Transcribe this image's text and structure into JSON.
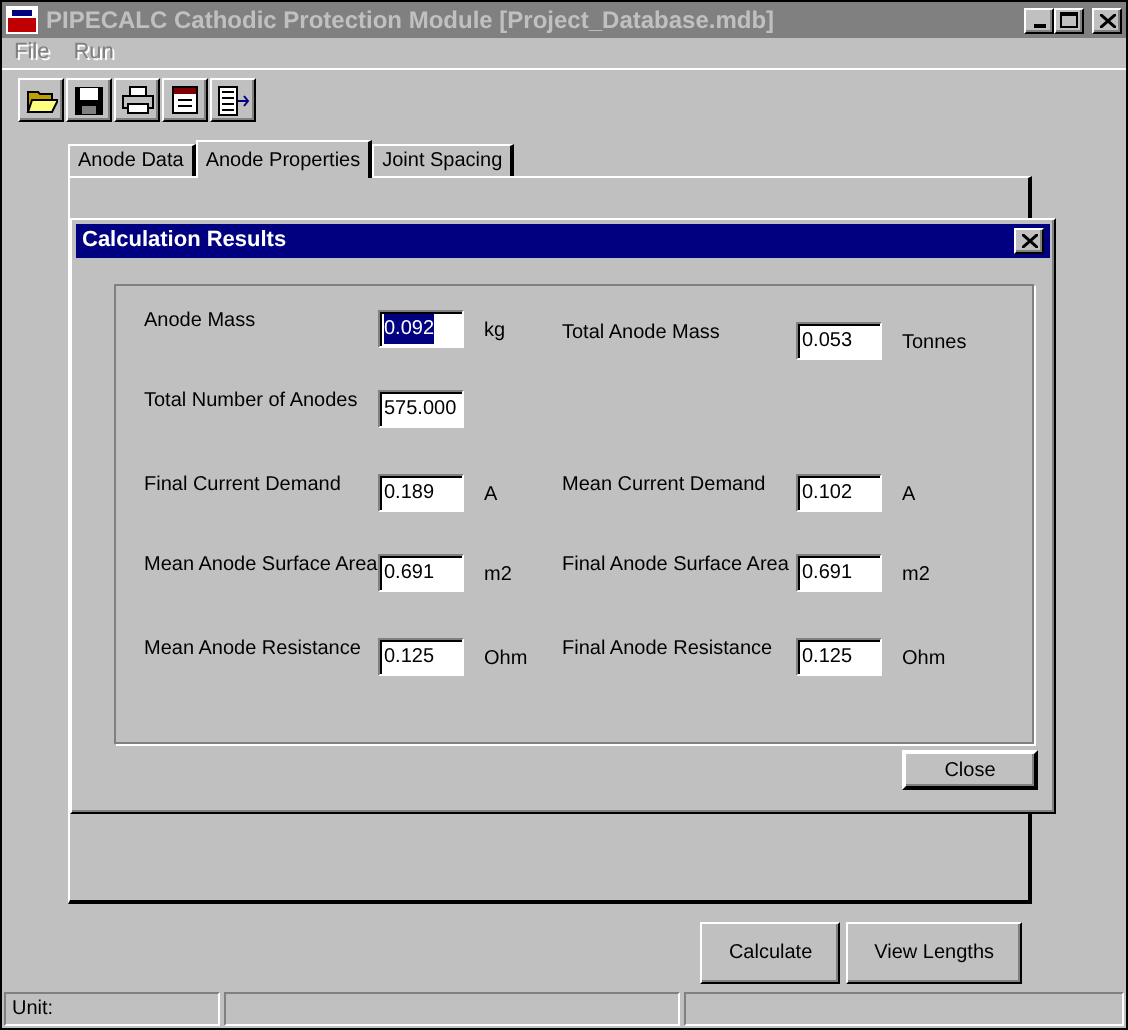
{
  "window": {
    "title": "PIPECALC Cathodic Protection Module [Project_Database.mdb]",
    "active": false
  },
  "menu": [
    {
      "label": "File",
      "disabled": true
    },
    {
      "label": "Run",
      "disabled": true
    }
  ],
  "toolbar": [
    {
      "kind": "open"
    },
    {
      "kind": "save"
    },
    {
      "kind": "print"
    },
    {
      "kind": "calendar"
    },
    {
      "kind": "export"
    }
  ],
  "tabs": [
    {
      "label": "Anode Data",
      "selected": false
    },
    {
      "label": "Anode Properties",
      "selected": true
    },
    {
      "label": "Joint Spacing",
      "selected": false
    }
  ],
  "dialog": {
    "title": "Calculation Results",
    "rows": [
      {
        "left": {
          "label": "Anode Mass",
          "value": "0.092",
          "unit": "kg",
          "highlighted": true
        },
        "right": {
          "label": "Total Anode Mass",
          "value": "0.053",
          "unit": "Tonnes",
          "highlighted": false
        }
      },
      {
        "left": {
          "label": "Total Number of Anodes",
          "value": "575.000",
          "highlighted": false
        }
      },
      {
        "left": {
          "label": "Final Current Demand",
          "value": "0.189",
          "unit": "A",
          "highlighted": false
        },
        "right": {
          "label": "Mean Current Demand",
          "value": "0.102",
          "unit": "A",
          "highlighted": false
        }
      },
      {
        "left": {
          "label": "Mean Anode Surface Area",
          "value": "0.691",
          "unit": "m2",
          "highlighted": false
        },
        "right": {
          "label": "Final Anode Surface Area",
          "value": "0.691",
          "unit": "m2",
          "highlighted": false
        }
      },
      {
        "left": {
          "label": "Mean Anode Resistance",
          "value": "0.125",
          "unit": "Ohm",
          "highlighted": false
        },
        "right": {
          "label": "Final Anode Resistance",
          "value": "0.125",
          "unit": "Ohm",
          "highlighted": false
        }
      }
    ],
    "close_button": "Close"
  },
  "buttons": [
    "Calculate",
    "View Lengths"
  ],
  "status_bar": [
    "Unit:"
  ]
}
